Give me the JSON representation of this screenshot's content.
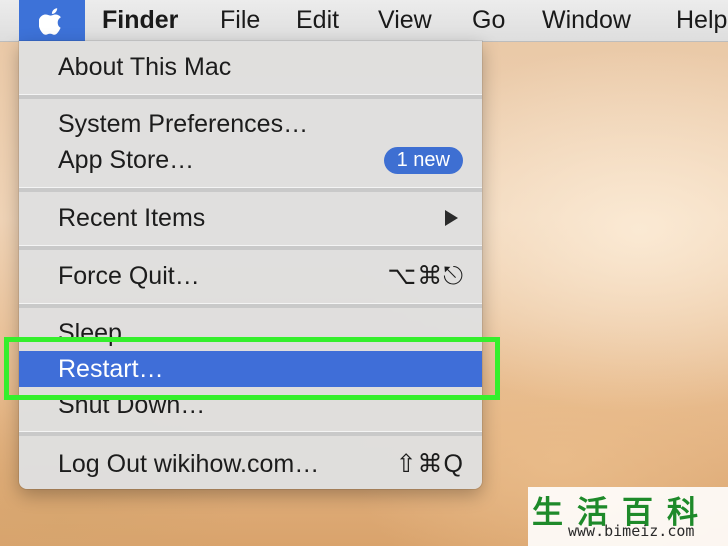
{
  "menubar": {
    "apple_icon": "apple-logo",
    "items": [
      "Finder",
      "File",
      "Edit",
      "View",
      "Go",
      "Window",
      "Help"
    ]
  },
  "apple_menu": {
    "about": "About This Mac",
    "system_preferences": "System Preferences…",
    "app_store": "App Store…",
    "app_store_badge": "1 new",
    "recent_items": "Recent Items",
    "force_quit": "Force Quit…",
    "force_quit_shortcut": "⌥⌘⎋",
    "sleep": "Sleep",
    "restart": "Restart…",
    "shut_down": "Shut Down…",
    "log_out": "Log Out wikihow.com…",
    "log_out_shortcut": "⇧⌘Q"
  },
  "highlight_color": "#35ef2c",
  "selection_color": "#3f6ed8",
  "watermark": {
    "chinese": "生活百科",
    "url": "www.bimeiz.com"
  }
}
